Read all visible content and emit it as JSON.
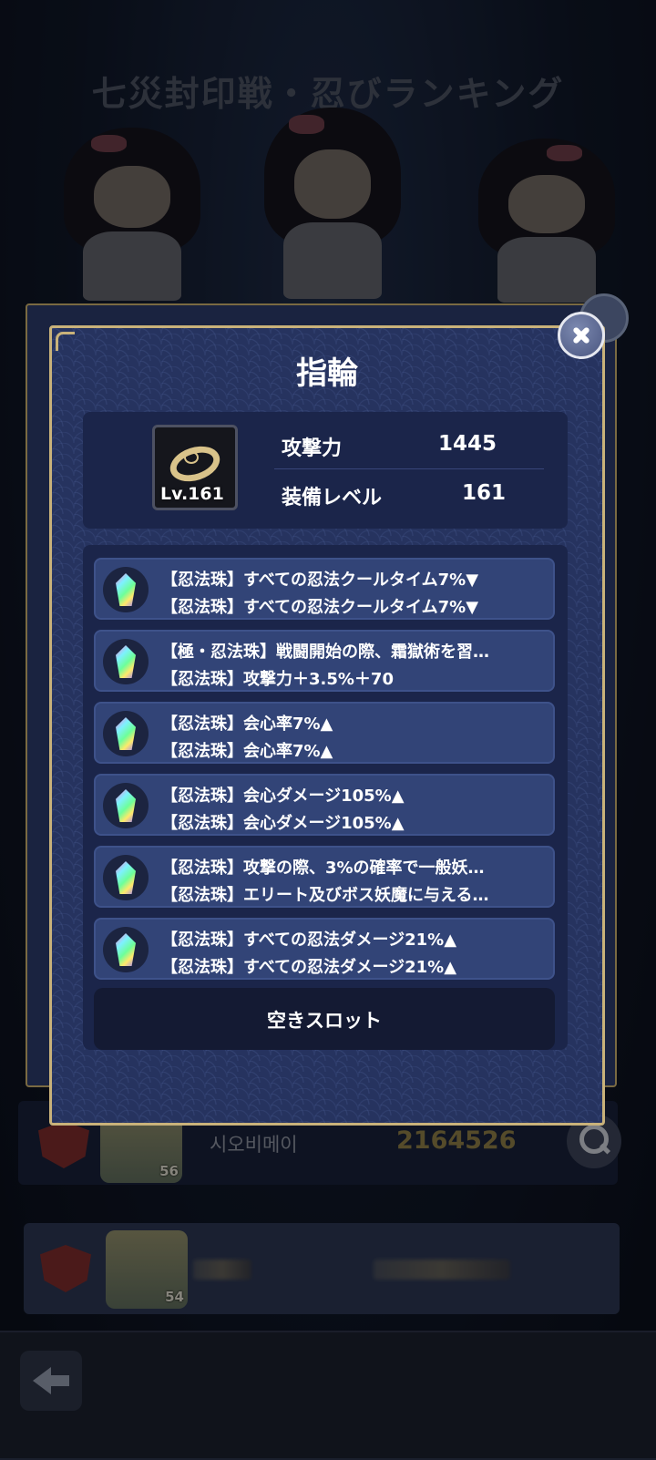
{
  "background": {
    "title": "七災封印戦・忍びランキング",
    "rows": [
      {
        "name": "시오비메이",
        "score": "2164526",
        "level": "56"
      },
      {
        "name": "",
        "score": "",
        "level": "54"
      }
    ]
  },
  "modal": {
    "title": "指輪",
    "item": {
      "level_label": "Lv.161",
      "icon": "ring-icon"
    },
    "stats": [
      {
        "label": "攻撃力",
        "value": "1445"
      },
      {
        "label": "装備レベル",
        "value": "161"
      }
    ],
    "gems": [
      {
        "line1": "【忍法珠】すべての忍法クールタイム7%▼",
        "line2": "【忍法珠】すべての忍法クールタイム7%▼"
      },
      {
        "line1": "【極・忍法珠】戦闘開始の際、霜獄術を習…",
        "line2": "【忍法珠】攻撃力＋3.5%＋70"
      },
      {
        "line1": "【忍法珠】会心率7%▲",
        "line2": "【忍法珠】会心率7%▲"
      },
      {
        "line1": "【忍法珠】会心ダメージ105%▲",
        "line2": "【忍法珠】会心ダメージ105%▲"
      },
      {
        "line1": "【忍法珠】攻撃の際、3%の確率で一般妖…",
        "line2": "【忍法珠】エリート及びボス妖魔に与える…"
      },
      {
        "line1": "【忍法珠】すべての忍法ダメージ21%▲",
        "line2": "【忍法珠】すべての忍法ダメージ21%▲"
      }
    ],
    "empty_slot_label": "空きスロット"
  },
  "colors": {
    "modal_bg": "#26335f",
    "modal_border": "#c9b27a",
    "gem_row_bg": "#324477",
    "score_color": "#8a7a44"
  }
}
